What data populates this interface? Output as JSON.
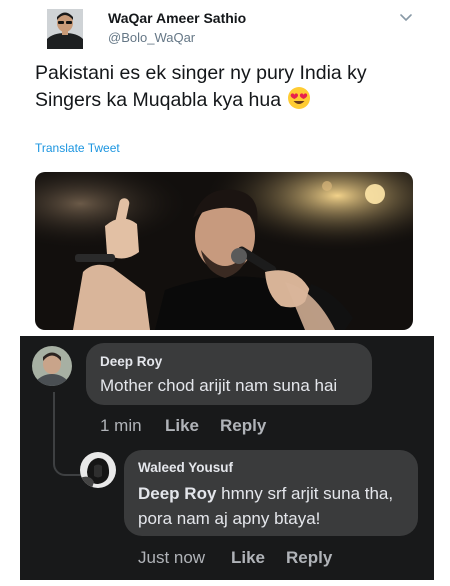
{
  "tweet": {
    "author_name": "WaQar Ameer Sathio",
    "author_handle": "@Bolo_WaQar",
    "text": "Pakistani es ek singer ny pury India ky Singers ka Muqabla kya hua",
    "emoji": "heart-eyes-emoji",
    "translate_label": "Translate Tweet",
    "link_color": "#1b95e0"
  },
  "comments": [
    {
      "author": "Deep Roy",
      "text": "Mother chod arijit nam suna hai",
      "time": "1 min",
      "like_label": "Like",
      "reply_label": "Reply"
    },
    {
      "author": "Waleed Yousuf",
      "mention": "Deep Roy",
      "text": " hmny srf arjit suna tha, pora nam aj apny btaya!",
      "time": "Just now",
      "like_label": "Like",
      "reply_label": "Reply"
    }
  ],
  "theme": {
    "comments_background": "#18191a",
    "bubble_color": "#3a3b3c",
    "meta_text_color": "#b0b3b8"
  }
}
